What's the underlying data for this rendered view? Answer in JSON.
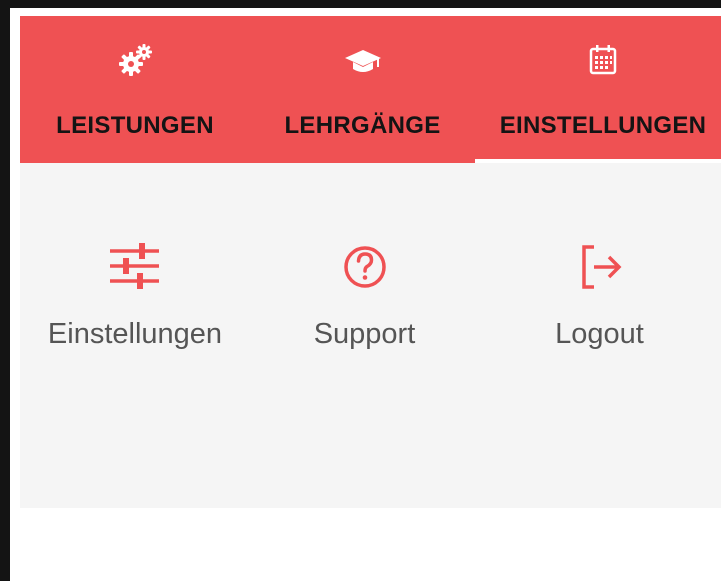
{
  "colors": {
    "header_bg": "#ef5153",
    "accent": "#ef5153",
    "tab_text": "#141414",
    "content_bg": "#f5f5f5",
    "item_text": "#555555",
    "indicator": "#ffffff"
  },
  "tabs": [
    {
      "label": "LEISTUNGEN",
      "icon": "gears-icon",
      "active": false
    },
    {
      "label": "LEHRGÄNGE",
      "icon": "graduation-cap-icon",
      "active": false
    },
    {
      "label": "EINSTELLUNGEN",
      "icon": "calendar-icon",
      "active": true
    }
  ],
  "items": [
    {
      "label": "Einstellungen",
      "icon": "sliders-icon"
    },
    {
      "label": "Support",
      "icon": "help-circle-icon"
    },
    {
      "label": "Logout",
      "icon": "logout-icon"
    }
  ]
}
